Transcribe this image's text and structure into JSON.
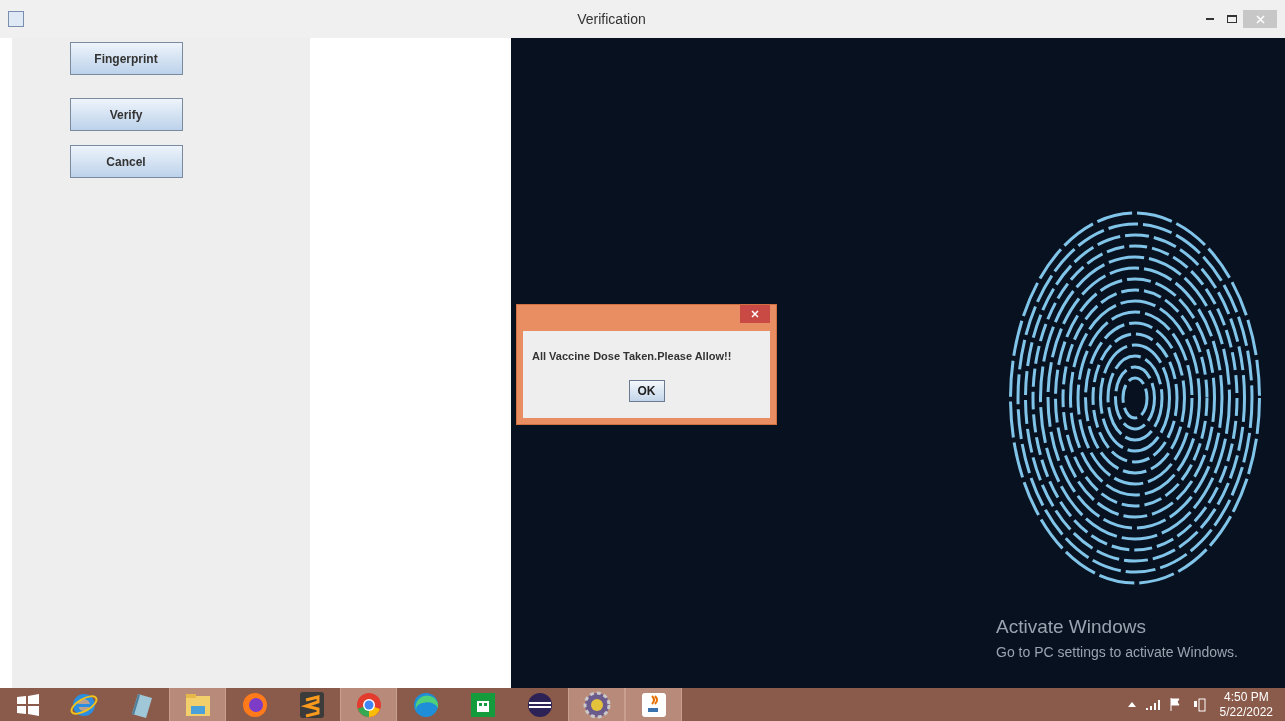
{
  "window": {
    "title": "Verification"
  },
  "buttons": [
    {
      "label": "Fingerprint"
    },
    {
      "label": "Verify"
    },
    {
      "label": "Cancel"
    }
  ],
  "dialog": {
    "message": "All Vaccine Dose Taken.Please Allow!!",
    "button": "OK"
  },
  "activation_notice": {
    "title": "Activate Windows",
    "subtitle": "Go to PC settings to activate Windows."
  },
  "taskbar": {
    "apps": [
      {
        "kind": "ie",
        "running": false
      },
      {
        "kind": "notepad",
        "running": false
      },
      {
        "kind": "folder",
        "running": true
      },
      {
        "kind": "firefox",
        "running": false
      },
      {
        "kind": "sublime",
        "running": false
      },
      {
        "kind": "chrome",
        "running": true
      },
      {
        "kind": "edge",
        "running": false
      },
      {
        "kind": "store",
        "running": false
      },
      {
        "kind": "eclipse",
        "running": false
      },
      {
        "kind": "gear",
        "running": true
      },
      {
        "kind": "java",
        "running": true
      }
    ],
    "time": "4:50 PM",
    "date": "5/22/2022"
  }
}
